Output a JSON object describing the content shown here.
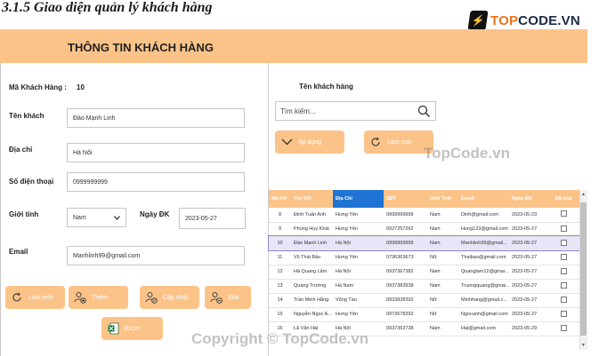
{
  "heading": "3.1.5 Giao diện quản lý khách hàng",
  "logo": {
    "brand_prefix": "TOP",
    "brand_suffix": "CODE.VN"
  },
  "window": {
    "title": "THÔNG TIN KHÁCH HÀNG"
  },
  "form": {
    "id_label": "Mã Khách Hàng :",
    "id_value": "10",
    "name_label": "Tên khách",
    "name_value": "Đào Mạnh Linh",
    "address_label": "Địa chỉ",
    "address_value": "Hà Nội",
    "phone_label": "Số điện thoại",
    "phone_value": "0999999999",
    "gender_label": "Giới tính",
    "gender_value": "Nam",
    "date_label": "Ngày ĐK",
    "date_value": "2023-05-27",
    "email_label": "Email",
    "email_value": "Manhlinh99@gmail.com"
  },
  "actions": {
    "refresh": "Làm mới",
    "add": "Thêm",
    "update": "Cập nhật",
    "delete": "Xóa",
    "excel": "Excel"
  },
  "search": {
    "label": "Tên khách hàng",
    "placeholder": "Tìm kiếm...",
    "apply": "Áp dụng",
    "reset": "Làm mới"
  },
  "watermarks": {
    "center": "TopCode.vn",
    "bottom": "Copyright © TopCode.vn"
  },
  "table": {
    "columns": [
      "Mã KH",
      "Tên KH",
      "Địa Chỉ",
      "SĐT",
      "Giới Tính",
      "Email",
      "Ngày ĐK",
      "Đã Xóa"
    ],
    "rows": [
      [
        "8",
        "Đinh Tuấn Anh",
        "Hưng Yên",
        "0999999999",
        "Nam",
        "Dinh@gmail.com",
        "2023-05-23"
      ],
      [
        "9",
        "Phùng Huy Khải",
        "Hưng Yên",
        "0927257262",
        "Nam",
        "Hung123@gmail.com",
        "2023-05-27"
      ],
      [
        "10",
        "Đào Mạnh Linh",
        "Hà Nội",
        "0999999999",
        "Nam",
        "Manhlinh99@gmail...",
        "2023-05-27"
      ],
      [
        "11",
        "Vũ Thái Bảo",
        "Hưng Yên",
        "0736363673",
        "Nữ",
        "Thaibao@gmail.com",
        "2023-05-27"
      ],
      [
        "12",
        "Hà Quang Lâm",
        "Hà Nội",
        "0937367382",
        "Nam",
        "Quanglam12@gmai...",
        "2023-05-27"
      ],
      [
        "13",
        "Quang Trường",
        "Hà Nam",
        "0937383938",
        "Nam",
        "Truongquang@gmai...",
        "2023-05-27"
      ],
      [
        "14",
        "Trần Minh Hằng",
        "Vũng Tàu",
        "0933838392",
        "Nữ",
        "Minhhang@gmail.c...",
        "2023-05-27"
      ],
      [
        "15",
        "Nguyễn Ngọc A...",
        "Hưng Yên",
        "0973678392",
        "Nữ",
        "Ngocanh@gmail.com",
        "2023-05-27"
      ],
      [
        "16",
        "Lã Văn Hải",
        "Hà Nội",
        "0937363738",
        "Nam",
        "Hai@gmail.com",
        "2023-05-29"
      ]
    ],
    "selected_row": 2
  },
  "colors": {
    "accent": "#fcc389",
    "header_active": "#1f73d4",
    "selection": "#e6e6f7"
  }
}
